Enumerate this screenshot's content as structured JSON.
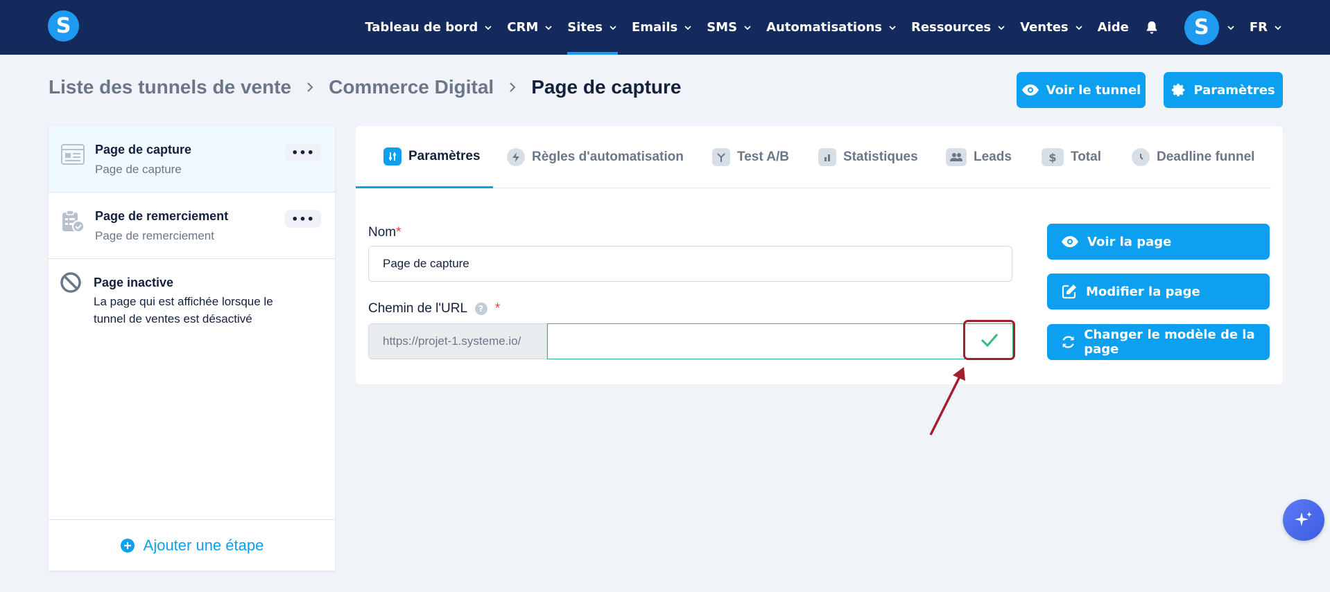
{
  "nav": {
    "logo_letter": "S",
    "items": [
      {
        "label": "Tableau de bord",
        "has_menu": true
      },
      {
        "label": "CRM",
        "has_menu": true
      },
      {
        "label": "Sites",
        "has_menu": true,
        "active": true
      },
      {
        "label": "Emails",
        "has_menu": true
      },
      {
        "label": "SMS",
        "has_menu": true
      },
      {
        "label": "Automatisations",
        "has_menu": true
      },
      {
        "label": "Ressources",
        "has_menu": true
      },
      {
        "label": "Ventes",
        "has_menu": true
      },
      {
        "label": "Aide",
        "has_menu": false
      }
    ],
    "avatar_letter": "S",
    "language": "FR"
  },
  "breadcrumb": {
    "items": [
      "Liste des tunnels de vente",
      "Commerce Digital"
    ],
    "current": "Page de capture"
  },
  "header_buttons": {
    "view_funnel": "Voir le tunnel",
    "settings": "Paramètres"
  },
  "steps": {
    "items": [
      {
        "title": "Page de capture",
        "subtitle": "Page de capture",
        "icon": "page-layout-icon",
        "selected": true
      },
      {
        "title": "Page de remerciement",
        "subtitle": "Page de remerciement",
        "icon": "clipboard-check-icon",
        "selected": false
      }
    ],
    "inactive": {
      "title": "Page inactive",
      "line1": "La page qui est affichée lorsque le",
      "line2": "tunnel de ventes est désactivé"
    },
    "dots": "•••",
    "add_label": "Ajouter une étape"
  },
  "tabs": [
    {
      "label": "Paramètres",
      "icon": "sliders-icon",
      "active": true
    },
    {
      "label": "Règles d'automatisation",
      "icon": "bolt-icon"
    },
    {
      "label": "Test A/B",
      "icon": "split-icon"
    },
    {
      "label": "Statistiques",
      "icon": "bar-chart-icon"
    },
    {
      "label": "Leads",
      "icon": "users-icon"
    },
    {
      "label": "Total",
      "icon": "dollar-icon"
    },
    {
      "label": "Deadline funnel",
      "icon": "clock-icon"
    }
  ],
  "form": {
    "name_label": "Nom",
    "name_value": "Page de capture",
    "required_mark": "*",
    "url_label": "Chemin de l'URL",
    "help_mark": "?",
    "url_prefix": "https://projet-1.systeme.io/",
    "url_path_value": ""
  },
  "side_buttons": {
    "view_page": "Voir la page",
    "edit_page": "Modifier la page",
    "change_template": "Changer le modèle de la page"
  },
  "colors": {
    "nav_bg": "#142a5c",
    "accent": "#0d9ff0",
    "success": "#37b97a",
    "highlight": "#a31f2c"
  }
}
